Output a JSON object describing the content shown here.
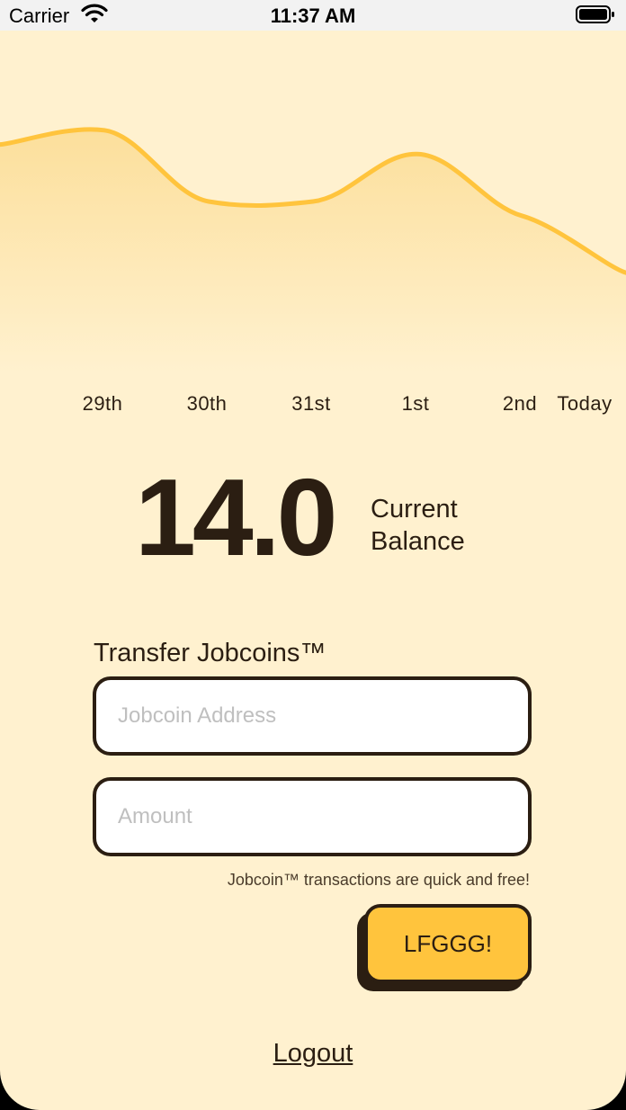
{
  "status_bar": {
    "carrier": "Carrier",
    "time": "11:37 AM",
    "wifi_icon": "wifi-icon",
    "battery_icon": "battery-full-icon"
  },
  "chart_data": {
    "type": "area",
    "x": [
      "",
      "29th",
      "30th",
      "31st",
      "1st",
      "2nd",
      "Today"
    ],
    "values": [
      24.0,
      25.5,
      18.0,
      18.0,
      23.0,
      16.5,
      10.5
    ],
    "ylim": [
      0,
      36
    ],
    "line_color": "#FFC43D",
    "fill_color": "#FBD98A"
  },
  "balance": {
    "value": "14.0",
    "label": "Current Balance"
  },
  "transfer": {
    "title": "Transfer Jobcoins™",
    "address_placeholder": "Jobcoin Address",
    "address_value": "",
    "amount_placeholder": "Amount",
    "amount_value": "",
    "hint": "Jobcoin™ transactions are quick and free!",
    "submit_label": "LFGGG!"
  },
  "logout_label": "Logout",
  "colors": {
    "background": "#FFF1CF",
    "accent": "#FFC43D",
    "text": "#2B1E12"
  }
}
